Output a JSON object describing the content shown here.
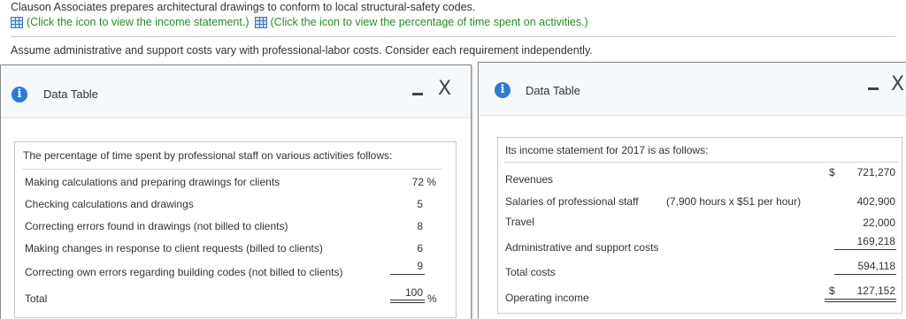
{
  "intro": {
    "text1": "Clauson Associates prepares architectural drawings to conform to local structural-safety codes.",
    "link1": "(Click the icon to view the income statement.)",
    "link2": "(Click the icon to view the percentage of time spent on activities.)",
    "text2": "Assume administrative and support costs vary with professional-labor costs. Consider each requirement independently."
  },
  "left_dialog": {
    "title": "Data Table",
    "info_glyph": "i",
    "close_glyph": "X",
    "heading": "The percentage of time spent by professional staff on various activities follows:",
    "rows": [
      {
        "label": "Making calculations and preparing drawings for clients",
        "value": "72 %"
      },
      {
        "label": "Checking calculations and drawings",
        "value": "5"
      },
      {
        "label": "Correcting errors found in drawings (not billed to clients)",
        "value": "8"
      },
      {
        "label": "Making changes in response to client requests (billed to clients)",
        "value": "6"
      },
      {
        "label": "Correcting own errors regarding building codes (not billed to clients)",
        "value": "9"
      }
    ],
    "total_label": "Total",
    "total_value": "100",
    "total_pct": "%"
  },
  "right_dialog": {
    "title": "Data Table",
    "info_glyph": "i",
    "close_glyph": "X",
    "heading": "Its income statement for 2017 is as follows:",
    "revenues_label": "Revenues",
    "revenues_dollar": "$",
    "revenues_value": "721,270",
    "salaries_label": "Salaries of professional staff",
    "salaries_detail": "(7,900 hours x $51 per hour)",
    "salaries_value": "402,900",
    "travel_label": "Travel",
    "travel_value": "22,000",
    "admin_label": "Administrative and support costs",
    "admin_value": "169,218",
    "total_costs_label": "Total costs",
    "total_costs_value": "594,118",
    "operating_label": "Operating income",
    "operating_dollar": "$",
    "operating_value": "127,152"
  }
}
